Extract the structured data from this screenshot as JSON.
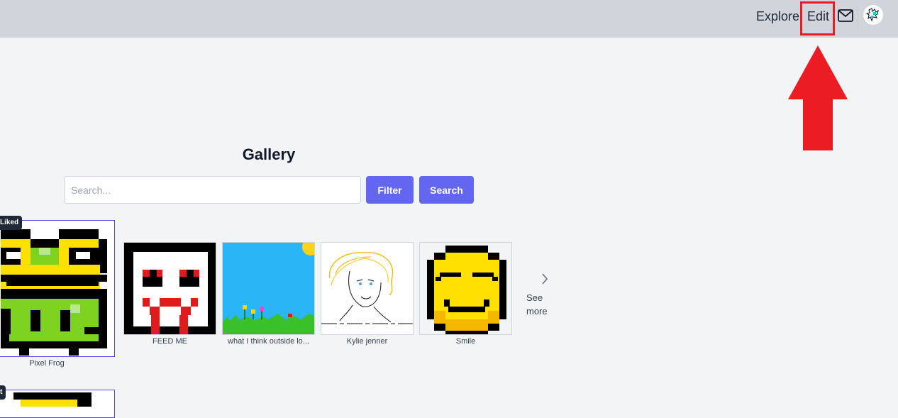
{
  "nav": {
    "explore_label": "Explore",
    "edit_label": "Edit",
    "mail_icon": "mail-icon",
    "avatar_icon": "user-avatar"
  },
  "annotation": {
    "arrow_color": "#ec1c24",
    "highlight_color": "#ec1c24"
  },
  "gallery": {
    "title": "Gallery",
    "search": {
      "placeholder": "Search...",
      "value": ""
    },
    "filter_label": "Filter",
    "search_label": "Search",
    "featured": [
      {
        "badge": "Liked",
        "caption": "Pixel Frog"
      },
      {
        "badge": "t",
        "caption": ""
      }
    ],
    "items": [
      {
        "caption": "FEED ME"
      },
      {
        "caption": "what I think outside lo..."
      },
      {
        "caption": "Kylie jenner"
      },
      {
        "caption": "Smile"
      }
    ],
    "see_more_label": "See more",
    "see_more_icon": "chevron-right-icon"
  },
  "colors": {
    "accent": "#6366f1",
    "topbar": "#d1d5db",
    "background": "#f3f4f6"
  }
}
